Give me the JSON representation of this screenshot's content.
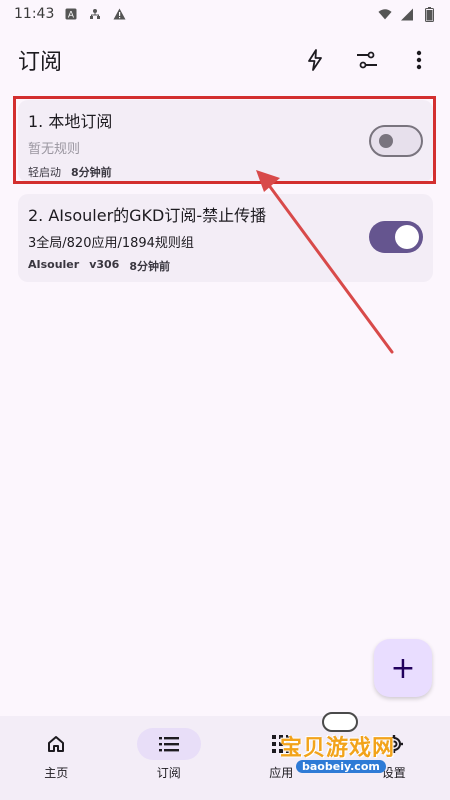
{
  "status_bar": {
    "time": "11:43",
    "left_icons": [
      "a-box-icon",
      "network-icon",
      "warning-icon"
    ],
    "right_icons": [
      "wifi-icon",
      "signal-icon",
      "battery-icon"
    ]
  },
  "app_bar": {
    "title": "订阅",
    "actions": [
      "flash-icon",
      "filter-icon",
      "more-vert-icon"
    ]
  },
  "subscriptions": [
    {
      "title": "1. 本地订阅",
      "description": "暂无规则",
      "meta_primary": "轻启动",
      "meta_secondary": "8分钟前",
      "enabled": false
    },
    {
      "title": "2. AIsouler的GKD订阅-禁止传播",
      "description": "3全局/820应用/1894规则组",
      "meta_primary": "AIsouler",
      "meta_version": "v306",
      "meta_secondary": "8分钟前",
      "enabled": true
    }
  ],
  "fab": {
    "label": "+"
  },
  "bottom_nav": {
    "items": [
      {
        "label": "主页",
        "icon": "home-icon",
        "active": false
      },
      {
        "label": "订阅",
        "icon": "list-icon",
        "active": true
      },
      {
        "label": "应用",
        "icon": "apps-icon",
        "active": false
      },
      {
        "label": "设置",
        "icon": "settings-icon",
        "active": false
      }
    ]
  },
  "watermark": {
    "text": "宝贝游戏网",
    "url": "baobeiy.com"
  },
  "colors": {
    "background": "#fcf6fd",
    "card": "#f3edf6",
    "toggle_on": "#65558f",
    "highlight": "#d32f2f",
    "fab": "#e9ddff"
  }
}
